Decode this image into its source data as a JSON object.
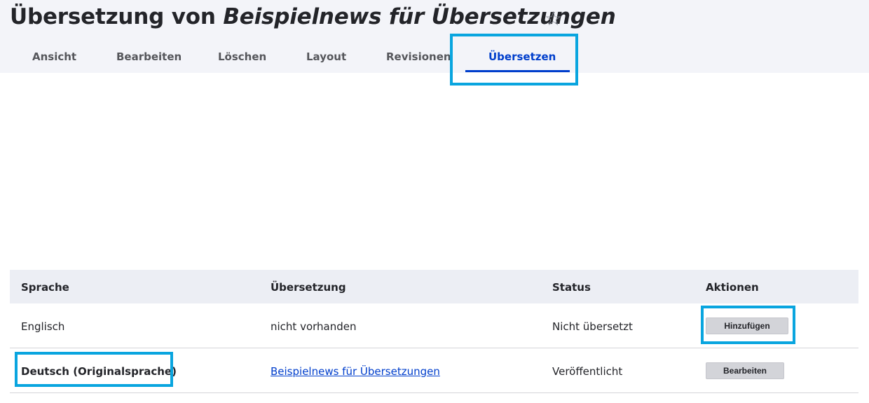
{
  "header": {
    "title_prefix": "Übersetzung von ",
    "title_node": "Beispielnews für Übersetzungen",
    "star_glyph": "☆"
  },
  "tabs": [
    {
      "label": "Ansicht"
    },
    {
      "label": "Bearbeiten"
    },
    {
      "label": "Löschen"
    },
    {
      "label": "Layout"
    },
    {
      "label": "Revisionen"
    },
    {
      "label": "Übersetzen",
      "active": true
    }
  ],
  "table": {
    "columns": [
      "Sprache",
      "Übersetzung",
      "Status",
      "Aktionen"
    ],
    "rows": [
      {
        "language": "Englisch",
        "translation": "nicht vorhanden",
        "status": "Nicht übersetzt",
        "action": "Hinzufügen"
      },
      {
        "language": "Deutsch (Originalsprache)",
        "translation": "Beispielnews für Übersetzungen",
        "status": "Veröffentlicht",
        "action": "Bearbeiten"
      }
    ]
  },
  "colors": {
    "accent": "#003ecc",
    "highlight": "#09a5df",
    "header_bg": "#f3f4f9",
    "table_head_bg": "#eceef4"
  }
}
